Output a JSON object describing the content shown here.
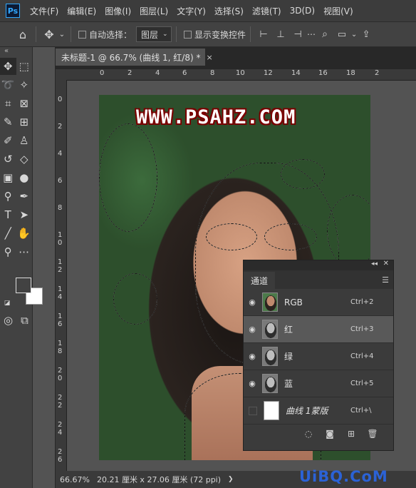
{
  "app": {
    "logo": "Ps"
  },
  "menu": [
    "文件(F)",
    "编辑(E)",
    "图像(I)",
    "图层(L)",
    "文字(Y)",
    "选择(S)",
    "滤镜(T)",
    "3D(D)",
    "视图(V)"
  ],
  "options": {
    "home_icon": "home-icon",
    "move_icon": "move-icon",
    "auto_select_label": "自动选择：",
    "layer_dropdown": "图层",
    "show_transform_label": "显示变换控件"
  },
  "document": {
    "tab_title": "未标题-1 @ 66.7% (曲线 1, 红/8) *",
    "watermark": "WWW.PSAHZ.COM"
  },
  "rulers": {
    "top": [
      "0",
      "2",
      "4",
      "6",
      "8",
      "10",
      "12",
      "14",
      "16",
      "18",
      "2"
    ],
    "left": [
      "0",
      "2",
      "4",
      "6",
      "8",
      "1 0",
      "1 2",
      "1 4",
      "1 6",
      "1 8",
      "2 0",
      "2 2",
      "2 4",
      "2 6"
    ]
  },
  "status": {
    "zoom": "66.67%",
    "doc_size": "20.21 厘米 x 27.06 厘米 (72 ppi)",
    "arrow": "❯"
  },
  "channels_panel": {
    "title": "通道",
    "rows": [
      {
        "name": "RGB",
        "shortcut": "Ctrl+2",
        "visible": true,
        "thumb": "rgb"
      },
      {
        "name": "红",
        "shortcut": "Ctrl+3",
        "visible": true,
        "thumb": "gray",
        "selected": true
      },
      {
        "name": "绿",
        "shortcut": "Ctrl+4",
        "visible": true,
        "thumb": "gray"
      },
      {
        "name": "蓝",
        "shortcut": "Ctrl+5",
        "visible": true,
        "thumb": "gray"
      },
      {
        "name": "曲线 1蒙版",
        "shortcut": "Ctrl+\\",
        "visible": false,
        "thumb": "white"
      }
    ]
  },
  "site_watermark": "UiBQ.CoM"
}
